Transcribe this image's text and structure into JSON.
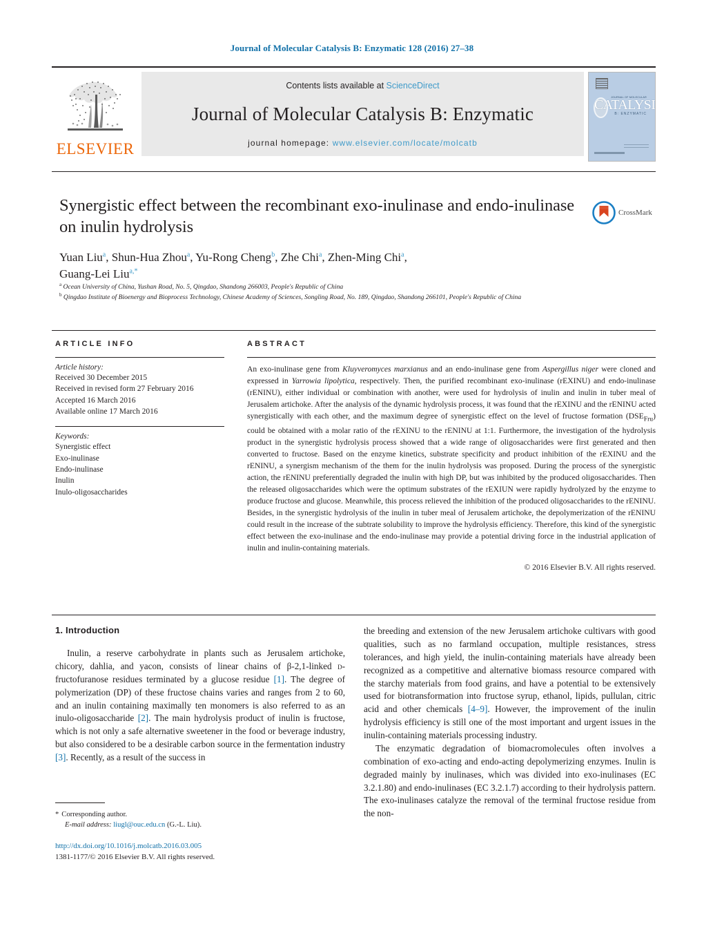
{
  "running_head": "Journal of Molecular Catalysis B: Enzymatic 128 (2016) 27–38",
  "masthead": {
    "publisher_name": "ELSEVIER",
    "contents_prefix": "Contents lists available at ",
    "contents_link": "ScienceDirect",
    "journal_title": "Journal of Molecular Catalysis B: Enzymatic",
    "homepage_prefix": "journal homepage: ",
    "homepage_url": "www.elsevier.com/locate/molcatb",
    "cover": {
      "supertitle": "JOURNAL OF MOLECULAR",
      "main": "CATALYSIS",
      "sub": "B: ENZYMATIC"
    }
  },
  "article": {
    "title": "Synergistic effect between the recombinant exo-inulinase and endo-inulinase on inulin hydrolysis",
    "authors_line1": "Yuan Liu a, Shun-Hua Zhou a, Yu-Rong Cheng b, Zhe Chi a, Zhen-Ming Chi a,",
    "authors_line2": "Guang-Lei Liu a,*",
    "affiliation_a": "Ocean University of China, Yushan Road, No. 5, Qingdao, Shandong 266003, People's Republic of China",
    "affiliation_b": "Qingdao Institute of Bioenergy and Bioprocess Technology, Chinese Academy of Sciences, Songling Road, No. 189, Qingdao, Shandong 266101, People's Republic of China",
    "crossmark_label": "CrossMark"
  },
  "article_info": {
    "heading": "ARTICLE INFO",
    "history_label": "Article history:",
    "history": [
      "Received 30 December 2015",
      "Received in revised form 27 February 2016",
      "Accepted 16 March 2016",
      "Available online 17 March 2016"
    ],
    "keywords_label": "Keywords:",
    "keywords": [
      "Synergistic effect",
      "Exo-inulinase",
      "Endo-inulinase",
      "Inulin",
      "Inulo-oligosaccharides"
    ]
  },
  "abstract": {
    "heading": "ABSTRACT",
    "p1_a": "An exo-inulinase gene from ",
    "p1_i1": "Kluyveromyces marxianus",
    "p1_b": " and an endo-inulinase gene from ",
    "p1_i2": "Aspergillus niger",
    "p1_c": " were cloned and expressed in ",
    "p1_i3": "Yarrowia lipolytica",
    "p1_d": ", respectively. Then, the purified recombinant exo-inulinase (rEXINU) and endo-inulinase (rENINU), either individual or combination with another, were used for hydrolysis of inulin and inulin in tuber meal of Jerusalem artichoke. After the analysis of the dynamic hydrolysis process, it was found that the rEXINU and the rENINU acted synergistically with each other, and the maximum degree of synergistic effect on the level of fructose formation (DSE",
    "p1_sub": "Fru",
    "p1_e": ") could be obtained with a molar ratio of the rEXINU to the rENINU at 1:1. Furthermore, the investigation of the hydrolysis product in the synergistic hydrolysis process showed that a wide range of oligosaccharides were first generated and then converted to fructose. Based on the enzyme kinetics, substrate specificity and product inhibition of the rEXINU and the rENINU, a synergism mechanism of the them for the inulin hydrolysis was proposed. During the process of the synergistic action, the rENINU preferentially degraded the inulin with high DP, but was inhibited by the produced oligosaccharides. Then the released oligosaccharides which were the optimum substrates of the rEXIUN were rapidly hydrolyzed by the enzyme to produce fructose and glucose. Meanwhile, this process relieved the inhibition of the produced oligosaccharides to the rENINU. Besides, in the synergistic hydrolysis of the inulin in tuber meal of Jerusalem artichoke, the depolymerization of the rENINU could result in the increase of the subtrate solubility to improve the hydrolysis efficiency. Therefore, this kind of the synergistic effect between the exo-inulinase and the endo-inulinase may provide a potential driving force in the industrial application of inulin and inulin-containing materials.",
    "copyright": "© 2016 Elsevier B.V. All rights reserved."
  },
  "body": {
    "section_heading": "1. Introduction",
    "left_p1_a": "Inulin, a reserve carbohydrate in plants such as Jerusalem artichoke, chicory, dahlia, and yacon, consists of linear chains of β-2,1-linked ",
    "left_p1_sc": "d",
    "left_p1_b": "-fructofuranose residues terminated by a glucose residue ",
    "left_ref1": "[1]",
    "left_p1_c": ". The degree of polymerization (DP) of these fructose chains varies and ranges from 2 to 60, and an inulin containing maximally ten monomers is also referred to as an inulo-oligosaccharide ",
    "left_ref2": "[2]",
    "left_p1_d": ". The main hydrolysis product of inulin is fructose, which is not only a safe alternative sweetener in the food or beverage industry, but also considered to be a desirable carbon source in the fermentation industry ",
    "left_ref3": "[3]",
    "left_p1_e": ". Recently, as a result of the success in",
    "right_p1_a": "the breeding and extension of the new Jerusalem artichoke cultivars with good qualities, such as no farmland occupation, multiple resistances, stress tolerances, and high yield, the inulin-containing materials have already been recognized as a competitive and alternative biomass resource compared with the starchy materials from food grains, and have a potential to be extensively used for biotransformation into fructose syrup, ethanol, lipids, pullulan, citric acid and other chemicals ",
    "right_ref1": "[4–9]",
    "right_p1_b": ". However, the improvement of the inulin hydrolysis efficiency is still one of the most important and urgent issues in the inulin-containing materials processing industry.",
    "right_p2": "The enzymatic degradation of biomacromolecules often involves a combination of exo-acting and endo-acting depolymerizing enzymes. Inulin is degraded mainly by inulinases, which was divided into exo-inulinases (EC 3.2.1.80) and endo-inulinases (EC 3.2.1.7) according to their hydrolysis pattern. The exo-inulinases catalyze the removal of the terminal fructose residue from the non-"
  },
  "footer": {
    "corresponding_star": "*",
    "corresponding_label": "Corresponding author.",
    "email_label": "E-mail address:",
    "email": "liugl@ouc.edu.cn",
    "email_suffix": "(G.-L. Liu).",
    "doi": "http://dx.doi.org/10.1016/j.molcatb.2016.03.005",
    "issn_line": "1381-1177/© 2016 Elsevier B.V. All rights reserved."
  },
  "colors": {
    "link_blue": "#1070a8",
    "sd_blue": "#3e9ac9",
    "elsevier_orange": "#ec6608",
    "cover_bg": "#b9cde4"
  }
}
